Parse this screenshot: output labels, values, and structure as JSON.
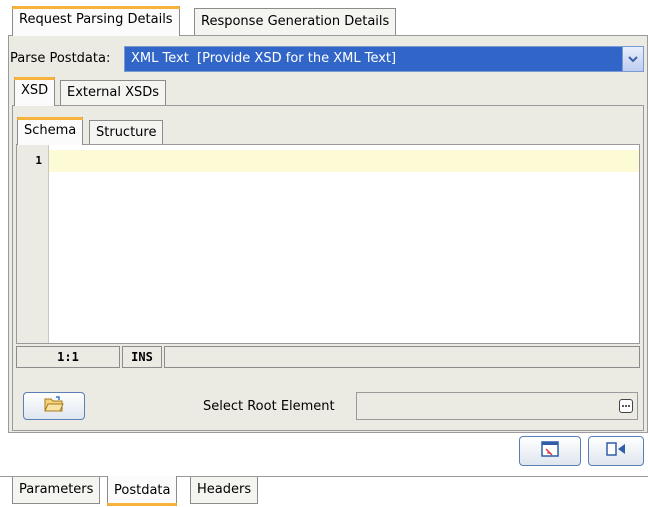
{
  "top_tabs": [
    {
      "label": "Request Parsing Details",
      "selected": true
    },
    {
      "label": "Response Generation Details",
      "selected": false
    }
  ],
  "parse_postdata": {
    "label": "Parse Postdata:",
    "value": "XML Text  [Provide XSD for the XML Text]"
  },
  "xsd_tabs": [
    {
      "label": "XSD",
      "selected": true
    },
    {
      "label": "External XSDs",
      "selected": false
    }
  ],
  "schema_tabs": [
    {
      "label": "Schema",
      "selected": true
    },
    {
      "label": "Structure",
      "selected": false
    }
  ],
  "editor": {
    "line_numbers": [
      "1"
    ],
    "content": ""
  },
  "status_bar": {
    "position": "1:1",
    "mode": "INS",
    "message": ""
  },
  "root_element": {
    "label": "Select Root Element",
    "value": ""
  },
  "bottom_tabs": [
    {
      "label": "Parameters",
      "selected": false
    },
    {
      "label": "Postdata",
      "selected": true
    },
    {
      "label": "Headers",
      "selected": false
    }
  ],
  "icons": {
    "open": "open-folder-icon",
    "browse": "ellipsis-icon",
    "combo": "chevron-down-icon",
    "action1": "document-window-icon",
    "action2": "page-arrow-icon"
  },
  "colors": {
    "selection": "#3166c8",
    "tab_accent": "#f5b23c",
    "current_line": "#fdfbd6",
    "panel": "#ecebe3"
  }
}
